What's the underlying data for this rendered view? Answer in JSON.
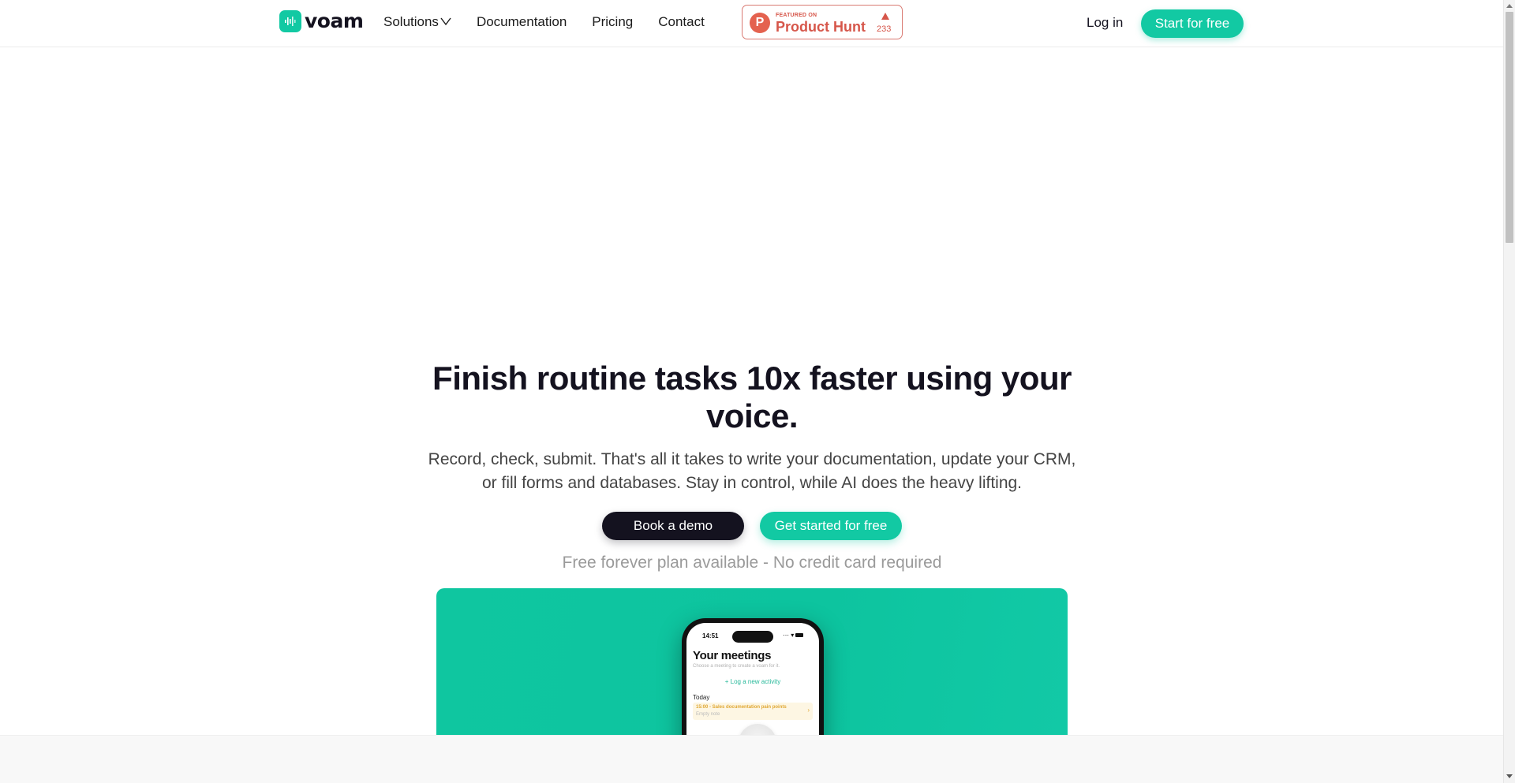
{
  "header": {
    "logo_text": "voam",
    "nav": [
      {
        "label": "Solutions",
        "has_dropdown": true
      },
      {
        "label": "Documentation"
      },
      {
        "label": "Pricing"
      },
      {
        "label": "Contact"
      }
    ],
    "product_hunt": {
      "small_label": "FEATURED ON",
      "big_label": "Product Hunt",
      "logo_letter": "P",
      "upvotes": "233"
    },
    "login_label": "Log in",
    "cta_label": "Start for free"
  },
  "hero": {
    "title": "Finish routine tasks 10x faster using your voice.",
    "subtitle": "Record, check, submit. That's all it takes to write your documentation, update your CRM, or fill forms and databases. Stay in control, while AI does the heavy lifting.",
    "buttons": {
      "demo": "Book a demo",
      "free": "Get started for free"
    },
    "note": "Free forever plan available - No credit card required"
  },
  "phone_mockup": {
    "time": "14:51",
    "title": "Your meetings",
    "description": "Choose a meeting to create a voam for it.",
    "log_activity": "Log a new activity",
    "section": "Today",
    "meeting": {
      "title": "15:00 - Sales documentation pain points",
      "subtitle": "Empty note"
    }
  },
  "colors": {
    "brand": "#12c9a3",
    "dark": "#14121f",
    "product_hunt": "#d6564a"
  }
}
